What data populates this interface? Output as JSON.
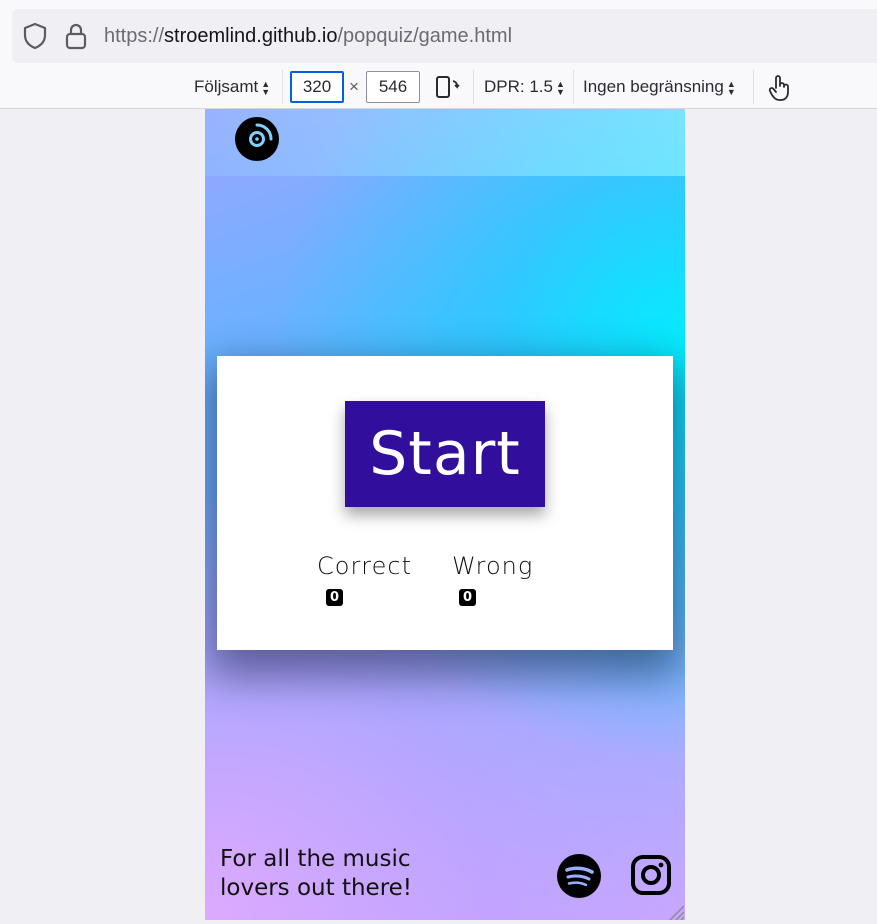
{
  "browser": {
    "url_scheme": "https://",
    "url_host": "stroemlind.github.io",
    "url_path": "/popquiz/game.html"
  },
  "rdm_toolbar": {
    "device": "Följsamt",
    "width": "320",
    "times": "×",
    "height": "546",
    "dpr": "DPR: 1.5",
    "throttling": "Ingen begränsning"
  },
  "game": {
    "start_label": "Start",
    "correct_label": "Correct",
    "wrong_label": "Wrong",
    "correct_score": "0",
    "wrong_score": "0"
  },
  "footer": {
    "line1": "For all the music",
    "line2": "lovers out there!"
  },
  "icons": {
    "logo": "disc-icon",
    "spotify": "spotify-icon",
    "instagram": "instagram-icon"
  }
}
